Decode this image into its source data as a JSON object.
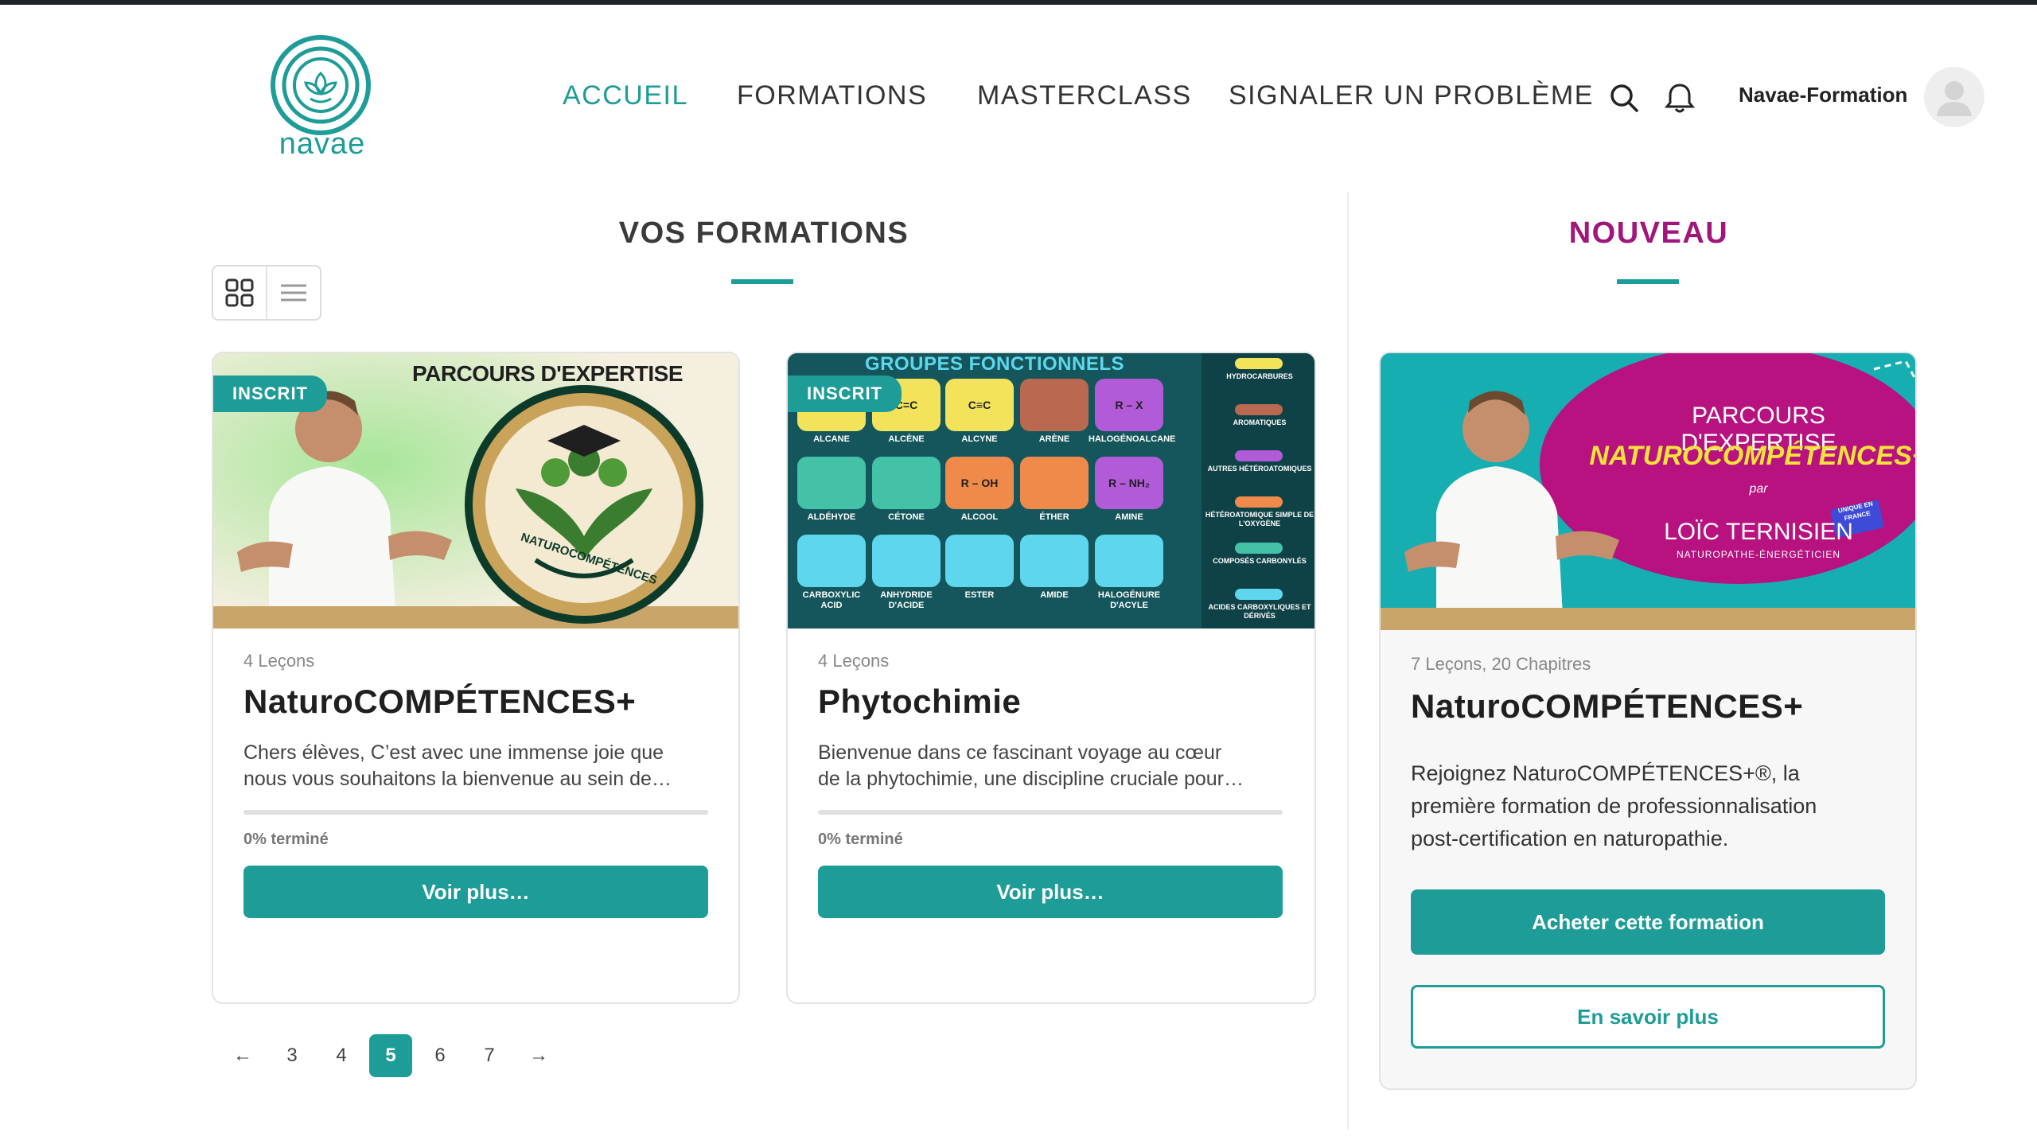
{
  "brand": {
    "name": "navae",
    "accent": "#1e9c97",
    "highlight": "#a0167a"
  },
  "nav": {
    "items": [
      {
        "label": "ACCUEIL",
        "active": true
      },
      {
        "label": "FORMATIONS",
        "active": false
      },
      {
        "label": "MASTERCLASS",
        "active": false
      },
      {
        "label": "SIGNALER UN PROBLÈME",
        "active": false
      }
    ],
    "search_icon": "search-icon",
    "notification_icon": "bell-icon",
    "username": "Navae-Formation",
    "avatar_icon": "user-avatar-icon"
  },
  "sections": {
    "mine_title": "VOS FORMATIONS",
    "new_title": "NOUVEAU"
  },
  "view_toggle": {
    "grid_icon": "grid-view-icon",
    "list_icon": "list-view-icon",
    "selected": "grid"
  },
  "courses": [
    {
      "badge": "INSCRIT",
      "image_heading": "PARCOURS D'EXPERTISE",
      "image_seal": "NATUROCOMPÉTENCES",
      "meta": "4 Leçons",
      "title": "NaturoCOMPÉTENCES+",
      "desc_line1": "Chers élèves, C’est avec une immense joie que",
      "desc_line2": "nous vous souhaitons la bienvenue au sein de…",
      "progress_label": "0% terminé",
      "progress": 0,
      "button": "Voir plus…"
    },
    {
      "badge": "INSCRIT",
      "image_heading": "GROUPES FONCTIONNELS",
      "image_cells": [
        {
          "formula": "",
          "label": "ALCANE",
          "color": "#f2e35b"
        },
        {
          "formula": "C=C",
          "label": "ALCÈNE",
          "color": "#f2e35b"
        },
        {
          "formula": "C≡C",
          "label": "ALCYNE",
          "color": "#f2e35b"
        },
        {
          "formula": "",
          "label": "ARÈNE",
          "color": "#b9694f"
        },
        {
          "formula": "R – X",
          "label": "HALOGÉNOALCANE",
          "color": "#b15bd9"
        },
        {
          "formula": "",
          "label": "ALDÉHYDE",
          "color": "#43c2a8"
        },
        {
          "formula": "",
          "label": "CÉTONE",
          "color": "#43c2a8"
        },
        {
          "formula": "R – OH",
          "label": "ALCOOL",
          "color": "#f08a4a"
        },
        {
          "formula": "",
          "label": "ÉTHER",
          "color": "#f08a4a"
        },
        {
          "formula": "R – NH₂",
          "label": "AMINE",
          "color": "#b15bd9"
        },
        {
          "formula": "",
          "label": "CARBOXYLIC ACID",
          "color": "#5ed7ee"
        },
        {
          "formula": "",
          "label": "ANHYDRIDE D'ACIDE",
          "color": "#5ed7ee"
        },
        {
          "formula": "",
          "label": "ESTER",
          "color": "#5ed7ee"
        },
        {
          "formula": "",
          "label": "AMIDE",
          "color": "#5ed7ee"
        },
        {
          "formula": "",
          "label": "HALOGÉNURE D'ACYLE",
          "color": "#5ed7ee"
        }
      ],
      "image_legend": [
        {
          "label": "HYDROCARBURES",
          "color": "#f2e35b"
        },
        {
          "label": "AROMATIQUES",
          "color": "#b9694f"
        },
        {
          "label": "AUTRES HÉTÉROATOMIQUES",
          "color": "#b15bd9"
        },
        {
          "label": "HÉTÉROATOMIQUE SIMPLE DE L'OXYGÈNE",
          "color": "#f08a4a"
        },
        {
          "label": "COMPOSÉS CARBONYLÉS",
          "color": "#43c2a8"
        },
        {
          "label": "ACIDES CARBOXYLIQUES ET DÉRIVÉS",
          "color": "#5ed7ee"
        }
      ],
      "meta": "4 Leçons",
      "title": "Phytochimie",
      "desc_line1": "Bienvenue dans ce fascinant voyage au cœur",
      "desc_line2": "de la phytochimie, une discipline cruciale pour…",
      "progress_label": "0% terminé",
      "progress": 0,
      "button": "Voir plus…"
    }
  ],
  "featured": {
    "image_heading": "PARCOURS D'EXPERTISE",
    "image_title": "NATUROCOMPÉTENCES+",
    "image_par": "par",
    "image_author": "LOÏC TERNISIEN",
    "image_role": "NATUROPATHE-ÉNERGÉTICIEN",
    "image_sticker": "UNIQUE EN FRANCE",
    "meta": "7 Leçons, 20 Chapitres",
    "title": "NaturoCOMPÉTENCES+",
    "desc_line1": "Rejoignez NaturoCOMPÉTENCES+®, la",
    "desc_line2": "première formation de professionnalisation",
    "desc_line3": "post-certification en naturopathie.",
    "buy_button": "Acheter cette formation",
    "more_button": "En savoir plus"
  },
  "pagination": {
    "prev": "←",
    "pages": [
      "3",
      "4",
      "5",
      "6",
      "7"
    ],
    "current": "5",
    "next": "→"
  }
}
